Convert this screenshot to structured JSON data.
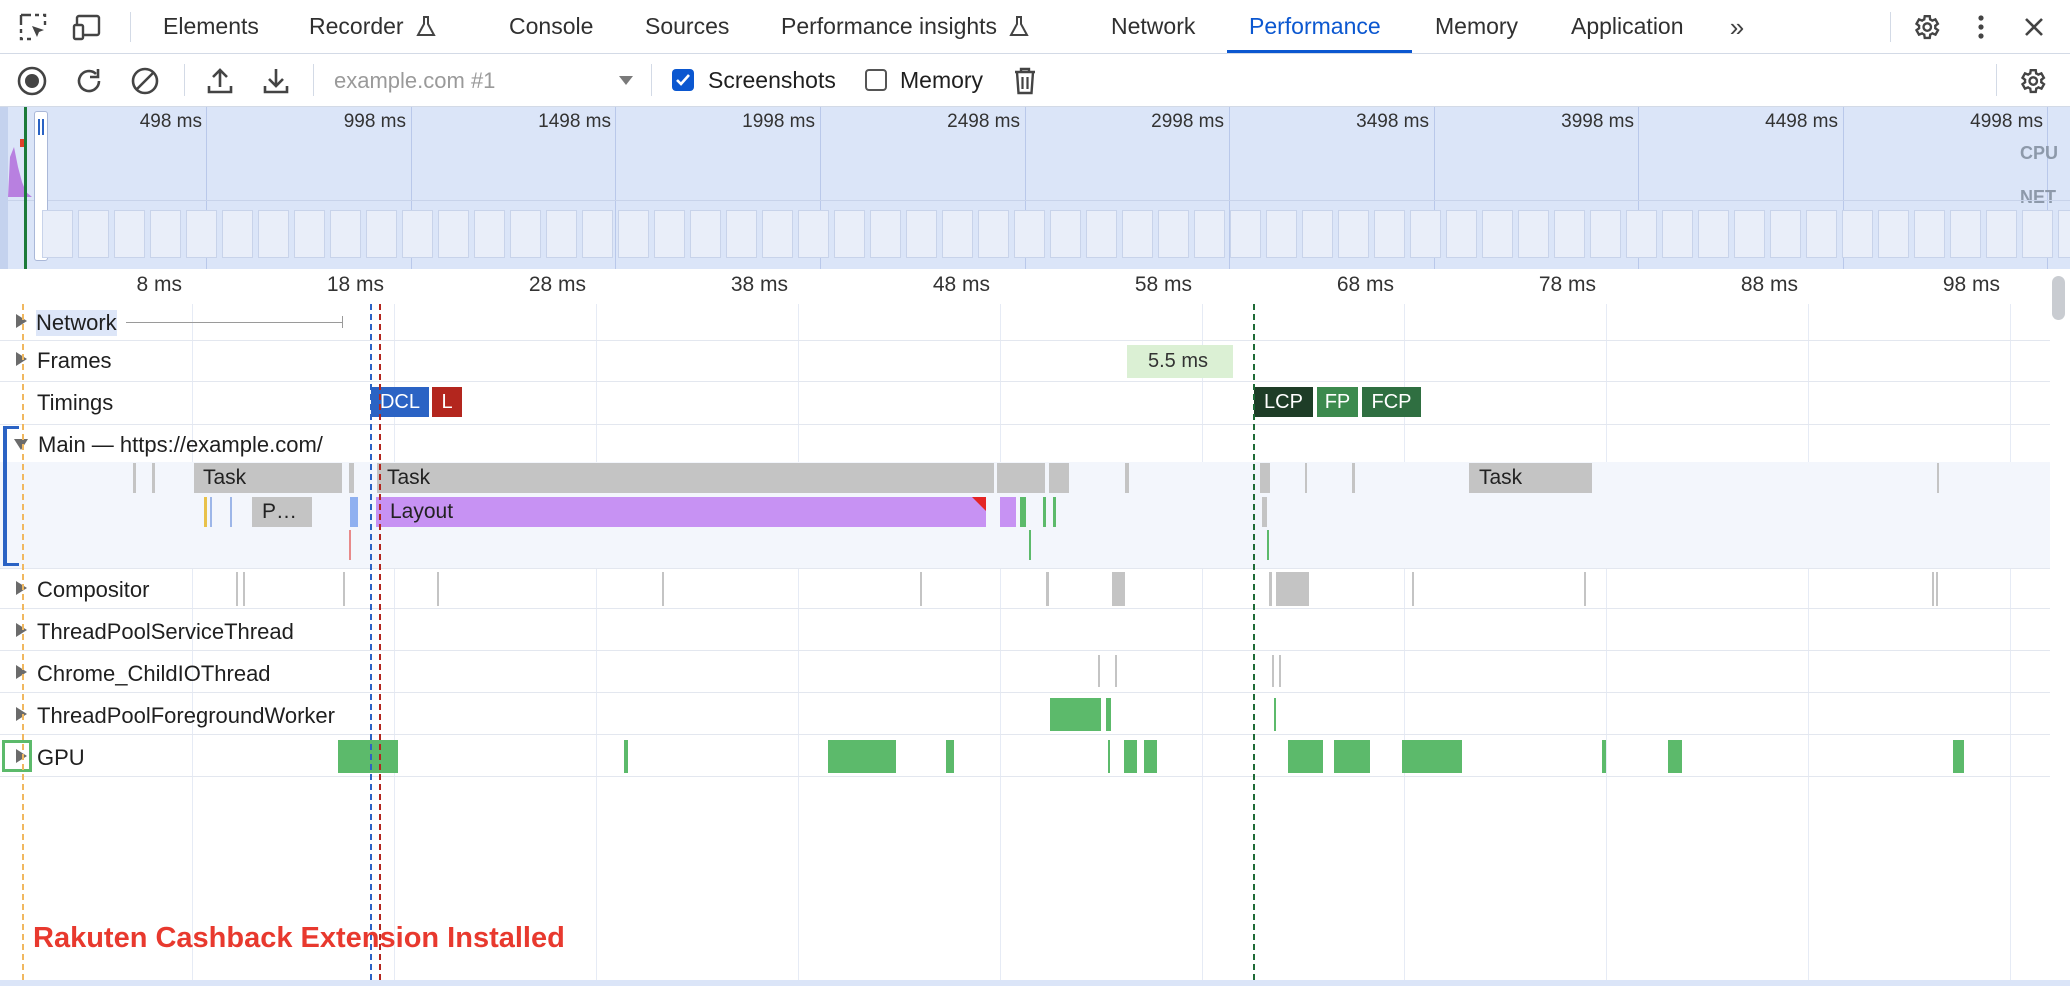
{
  "tabs": [
    {
      "label": "Elements"
    },
    {
      "label": "Recorder"
    },
    {
      "label": "Console"
    },
    {
      "label": "Sources"
    },
    {
      "label": "Performance insights"
    },
    {
      "label": "Network"
    },
    {
      "label": "Performance"
    },
    {
      "label": "Memory"
    },
    {
      "label": "Application"
    }
  ],
  "active_tab": "Performance",
  "toolbar": {
    "recording_select": "example.com #1",
    "screenshots_label": "Screenshots",
    "screenshots_checked": true,
    "memory_label": "Memory",
    "memory_checked": false
  },
  "overview": {
    "ticks": [
      "498 ms",
      "998 ms",
      "1498 ms",
      "1998 ms",
      "2498 ms",
      "2998 ms",
      "3498 ms",
      "3998 ms",
      "4498 ms",
      "4998 ms"
    ],
    "cpu_label": "CPU",
    "net_label": "NET"
  },
  "ruler": {
    "ticks": [
      "8 ms",
      "18 ms",
      "28 ms",
      "38 ms",
      "48 ms",
      "58 ms",
      "68 ms",
      "78 ms",
      "88 ms",
      "98 ms"
    ]
  },
  "tracks": {
    "network": "Network",
    "frames": "Frames",
    "frame_duration": "5.5 ms",
    "timings": "Timings",
    "main": "Main — https://example.com/",
    "compositor": "Compositor",
    "threadpool_service": "ThreadPoolServiceThread",
    "child_io": "Chrome_ChildIOThread",
    "threadpool_fg": "ThreadPoolForegroundWorker",
    "gpu": "GPU"
  },
  "timing_markers": {
    "dcl": "DCL",
    "l": "L",
    "lcp": "LCP",
    "fp": "FP",
    "fcp": "FCP"
  },
  "main_slices": {
    "task1": "Task",
    "task2": "Task",
    "task3": "Task",
    "p_slice": "P…",
    "layout": "Layout"
  },
  "overlay_text": "Rakuten Cashback Extension Installed",
  "colors": {
    "accent": "#0b57d0",
    "task": "#c4c4c4",
    "layout": "#c792f3",
    "gpu": "#5cba6b",
    "dcl": "#2b63c4",
    "l": "#b3261e",
    "lcp": "#1e3d27",
    "fp": "#3c8a4e",
    "fcp": "#2f6f41",
    "overlay_text": "#e8392e"
  }
}
